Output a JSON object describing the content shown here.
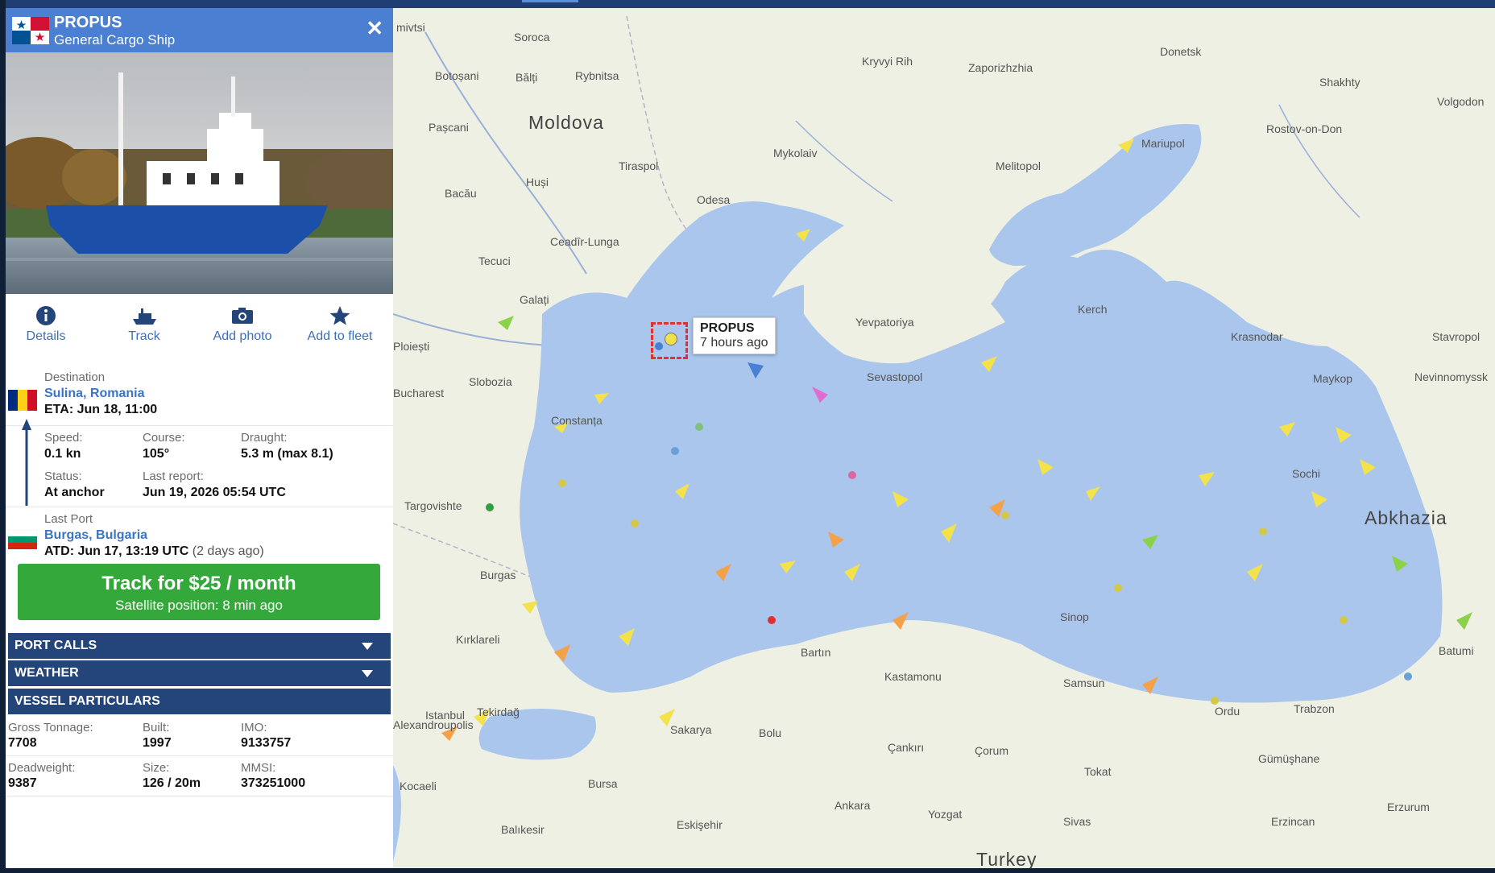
{
  "header": {
    "vessel_name": "PROPUS",
    "vessel_type": "General Cargo Ship",
    "flag_icon": "panama-flag-icon",
    "close_icon": "close-icon"
  },
  "actions": [
    {
      "label": "Details",
      "icon": "info-icon"
    },
    {
      "label": "Track",
      "icon": "ship-icon"
    },
    {
      "label": "Add photo",
      "icon": "camera-icon"
    },
    {
      "label": "Add to fleet",
      "icon": "star-icon"
    }
  ],
  "destination": {
    "label": "Destination",
    "value": "Sulina, Romania",
    "eta": "ETA: Jun 18, 11:00",
    "flag_icon": "romania-flag-icon"
  },
  "navigation": {
    "speed_label": "Speed:",
    "speed_value": "0.1 kn",
    "course_label": "Course:",
    "course_value": "105°",
    "draught_label": "Draught:",
    "draught_value": "5.3 m (max 8.1)",
    "status_label": "Status:",
    "status_value": "At anchor",
    "last_report_label": "Last report:",
    "last_report_value": "Jun 19, 2026 05:54 UTC"
  },
  "last_port": {
    "label": "Last Port",
    "value": "Burgas, Bulgaria",
    "atd": "ATD: Jun 17, 13:19 UTC",
    "atd_ago": "(2 days ago)",
    "flag_icon": "bulgaria-flag-icon"
  },
  "track_button": {
    "label": "Track for $25 / month",
    "sub": "Satellite position: 8 min ago"
  },
  "sections": {
    "port_calls": "PORT CALLS",
    "weather": "WEATHER",
    "vessel_particulars": "VESSEL PARTICULARS"
  },
  "particulars": {
    "gross_tonnage_label": "Gross Tonnage:",
    "gross_tonnage": "7708",
    "built_label": "Built:",
    "built": "1997",
    "imo_label": "IMO:",
    "imo": "9133757",
    "deadweight_label": "Deadweight:",
    "deadweight": "9387",
    "size_label": "Size:",
    "size": "126 / 20m",
    "mmsi_label": "MMSI:",
    "mmsi": "373251000"
  },
  "map": {
    "vessel_label": "PROPUS",
    "vessel_time": "7 hours ago",
    "places": [
      {
        "name": "Soroca"
      },
      {
        "name": "Botoșani"
      },
      {
        "name": "Bălți"
      },
      {
        "name": "Rybnitsa"
      },
      {
        "name": "Moldova"
      },
      {
        "name": "Pașcani"
      },
      {
        "name": "Kryvyi Rih"
      },
      {
        "name": "Zaporizhzhia"
      },
      {
        "name": "Donetsk"
      },
      {
        "name": "Shakhty"
      },
      {
        "name": "Volgodon"
      },
      {
        "name": "Mykolaiv"
      },
      {
        "name": "Tiraspol"
      },
      {
        "name": "Melitopol"
      },
      {
        "name": "Mariupol"
      },
      {
        "name": "Rostov-on-Don"
      },
      {
        "name": "Bacău"
      },
      {
        "name": "Huși"
      },
      {
        "name": "Odesa"
      },
      {
        "name": "Ceadîr-Lunga"
      },
      {
        "name": "Tecuci"
      },
      {
        "name": "Galați"
      },
      {
        "name": "Yevpatoriya"
      },
      {
        "name": "Kerch"
      },
      {
        "name": "Krasnodar"
      },
      {
        "name": "Stavropol"
      },
      {
        "name": "Ploiești"
      },
      {
        "name": "Bucharest"
      },
      {
        "name": "Slobozia"
      },
      {
        "name": "Sevastopol"
      },
      {
        "name": "Maykop"
      },
      {
        "name": "Nevinnomyssk"
      },
      {
        "name": "Constanța"
      },
      {
        "name": "Sochi"
      },
      {
        "name": "Targovishte"
      },
      {
        "name": "Abkhazia"
      },
      {
        "name": "Burgas"
      },
      {
        "name": "Sinop"
      },
      {
        "name": "Batumi"
      },
      {
        "name": "Kırklareli"
      },
      {
        "name": "Bartın"
      },
      {
        "name": "Kastamonu"
      },
      {
        "name": "Samsun"
      },
      {
        "name": "Ordu"
      },
      {
        "name": "Trabzon"
      },
      {
        "name": "Tekirdağ"
      },
      {
        "name": "Sakarya"
      },
      {
        "name": "Bolu"
      },
      {
        "name": "Çankırı"
      },
      {
        "name": "Çorum"
      },
      {
        "name": "Tokat"
      },
      {
        "name": "Gümüşhane"
      },
      {
        "name": "Bursa"
      },
      {
        "name": "Ankara"
      },
      {
        "name": "Yozgat"
      },
      {
        "name": "Sivas"
      },
      {
        "name": "Erzincan"
      },
      {
        "name": "Erzurum"
      },
      {
        "name": "Eskişehir"
      },
      {
        "name": "Balıkesir"
      },
      {
        "name": "Turkey"
      },
      {
        "name": "Istanbul"
      },
      {
        "name": "Alexandroupolis"
      },
      {
        "name": "Kocaeli"
      }
    ]
  },
  "colors": {
    "header_blue": "#4a7fd1",
    "section_bar": "#24457a",
    "track_green": "#34a83a",
    "link_blue": "#3b73c7",
    "sea": "#aac6ec",
    "land": "#eef0e3"
  }
}
